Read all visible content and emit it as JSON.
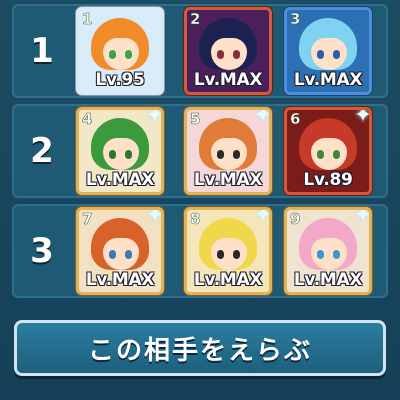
{
  "rows": [
    {
      "number": "1",
      "cards": [
        {
          "slot": "1",
          "level": "Lv.95",
          "frame": "silver",
          "bg": "#d9ecf9",
          "hair": "#f28b2a",
          "eye": "#3da24a",
          "sparkle": false
        },
        {
          "slot": "2",
          "level": "Lv.MAX",
          "frame": "red",
          "bg": "#4a1f5c",
          "hair": "#1c2150",
          "eye": "#8b2a3a",
          "sparkle": false
        },
        {
          "slot": "3",
          "level": "Lv.MAX",
          "frame": "blue",
          "bg": "#2c6fb3",
          "hair": "#7fd2f0",
          "eye": "#2a5ea8",
          "sparkle": false
        }
      ]
    },
    {
      "number": "2",
      "cards": [
        {
          "slot": "4",
          "level": "Lv.MAX",
          "frame": "gold",
          "bg": "#f2e7c6",
          "hair": "#3a9a3c",
          "eye": "#2d7a2d",
          "sparkle": true
        },
        {
          "slot": "5",
          "level": "Lv.MAX",
          "frame": "gold",
          "bg": "#f6d7d8",
          "hair": "#e07c3a",
          "eye": "#2a2a2a",
          "sparkle": true
        },
        {
          "slot": "6",
          "level": "Lv.89",
          "frame": "red",
          "bg": "#7a1c18",
          "hair": "#c63a2a",
          "eye": "#3a8a3a",
          "sparkle": true
        }
      ]
    },
    {
      "number": "3",
      "cards": [
        {
          "slot": "7",
          "level": "Lv.MAX",
          "frame": "gold",
          "bg": "#f2e1c2",
          "hair": "#d8622a",
          "eye": "#3a7ab5",
          "sparkle": true
        },
        {
          "slot": "8",
          "level": "Lv.MAX",
          "frame": "gold",
          "bg": "#f4e6b8",
          "hair": "#f0d84a",
          "eye": "#2a2a2a",
          "sparkle": true
        },
        {
          "slot": "9",
          "level": "Lv.MAX",
          "frame": "gold",
          "bg": "#f0e3cf",
          "hair": "#f2a9c8",
          "eye": "#3a9ad0",
          "sparkle": true
        }
      ]
    }
  ],
  "button": {
    "label": "この相手をえらぶ"
  },
  "icons": {
    "sparkle": "sparkle-icon"
  }
}
